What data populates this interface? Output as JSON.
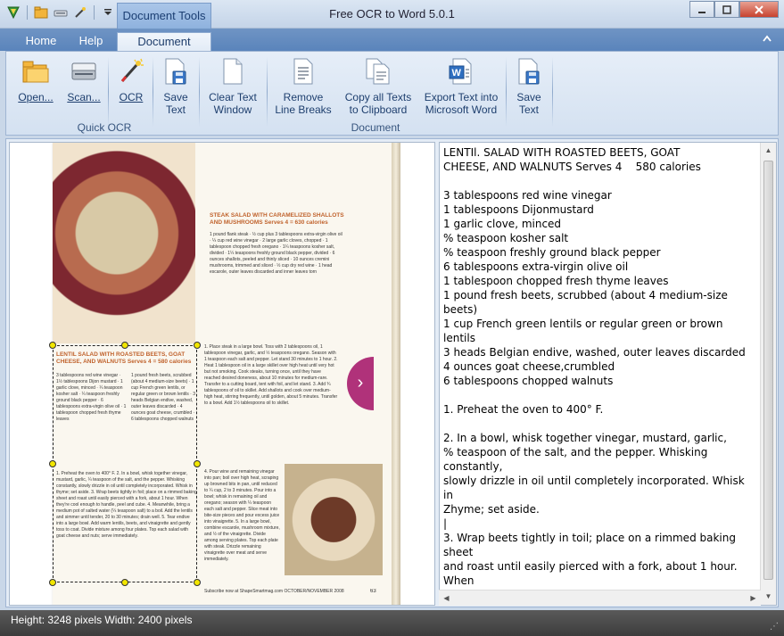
{
  "window": {
    "title": "Free OCR to Word 5.0.1",
    "context_tab": "Document Tools"
  },
  "tabs": {
    "home": "Home",
    "help": "Help",
    "document": "Document"
  },
  "ribbon": {
    "open": "Open...",
    "scan": "Scan...",
    "ocr": "OCR",
    "save_text_1": "Save",
    "save_text_2": "Text",
    "clear_1": "Clear Text",
    "clear_2": "Window",
    "remove_1": "Remove",
    "remove_2": "Line Breaks",
    "copy_1": "Copy all Texts",
    "copy_2": "to Clipboard",
    "export_1": "Export Text into",
    "export_2": "Microsoft Word",
    "save2_1": "Save",
    "save2_2": "Text",
    "group_quick_ocr": "Quick OCR",
    "group_document": "Document"
  },
  "preview": {
    "head_left": "LENTIL SALAD WITH ROASTED BEETS, GOAT CHEESE, AND WALNUTS Serves 4 = 580 calories",
    "head_right": "STEAK SALAD WITH CARAMELIZED SHALLOTS AND MUSHROOMS Serves 4 = 630 calories",
    "page_number": "63",
    "footer": "Subscribe now at ShapeSmartmag.com OCTOBER/NOVEMBER 2008"
  },
  "ocr_text": "LENTIl. SALAD WITH ROASTED BEETS, GOAT\nCHEESE, AND WALNUTS Serves 4    580 calories\n\n3 tablespoons red wine vinegar\n1 tablespoons Dijonmustard\n1 garlic clove, minced\n% teaspoon kosher salt\n% teaspoon freshly ground black pepper\n6 tablespoons extra-virgin olive oil\n1 tablespoon chopped fresh thyme leaves\n1 pound fresh beets, scrubbed (about 4 medium-size beets)\n1 cup French green lentils or regular green or brown lentils\n3 heads Belgian endive, washed, outer leaves discarded\n4 ounces goat cheese,crumbled\n6 tablespoons chopped walnuts\n\n1. Preheat the oven to 400° F.\n\n2. In a bowl, whisk together vinegar, mustard, garlic,\n% teaspoon of the salt, and the pepper. Whisking constantly,\nslowly drizzle in oil until completely incorporated. Whisk in\nZhyme; set aside.\n|\n3. Wrap beets tightly in toil; place on a rimmed baking sheet\nand roast until easily pierced with a fork, about 1 hour. When\nhey're cool enough to handle, peel and cube.\nl. Meanwhile, bring a medium pot ot salted water\n% teaspoon salt) to a boil. Add the lentils and simmer\nntil tender, 20 to 30 minutes; drain well.\n.Tear endive into a large bowl. Add warm lentils, beets, and\nnaigrette and gently toss to coat. Divide mixture among four",
  "status": {
    "text": "Height: 3248 pixels  Width: 2400 pixels"
  },
  "icons": {
    "open": "folder-icon",
    "scan": "scanner-icon",
    "ocr": "magic-wand-icon",
    "save": "save-icon",
    "clear": "blank-page-icon",
    "remove": "text-page-icon",
    "copy": "copy-pages-icon",
    "export": "word-doc-icon"
  },
  "colors": {
    "ribbon_text": "#1e3f6e",
    "tab_strip": "#6f94c4",
    "status_bar": "#3c3c3c"
  }
}
